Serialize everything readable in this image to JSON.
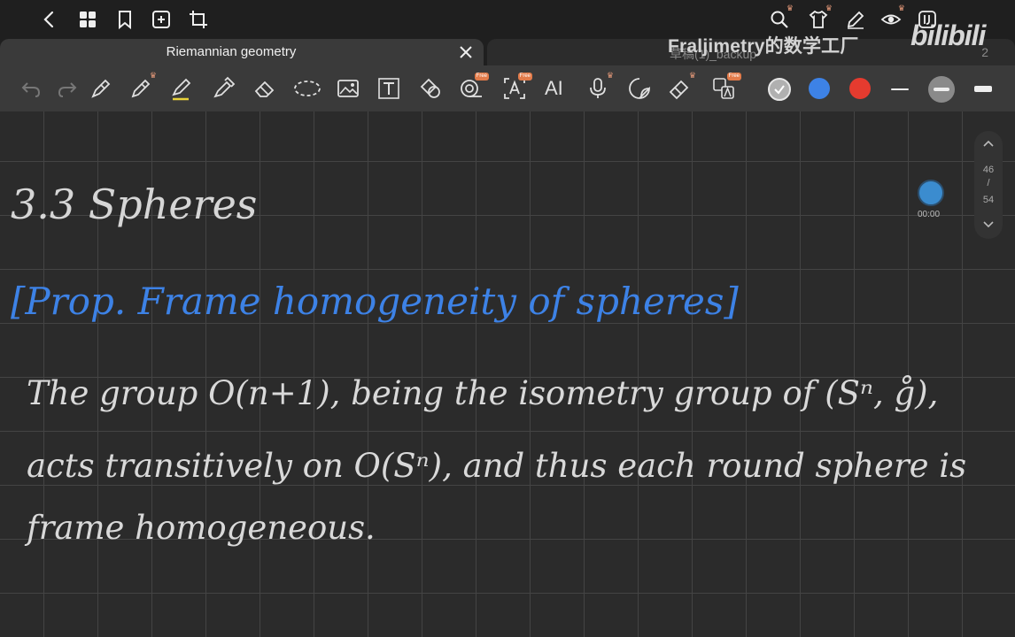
{
  "tabs": {
    "active": "Riemannian geometry",
    "inactive": "草稿(1)_backup",
    "inactive_count": "2"
  },
  "watermark": {
    "channel": "Fraljimetry的数学工厂",
    "site": "bilibili"
  },
  "pagination": {
    "current": "46",
    "separator": "/",
    "total": "54"
  },
  "recording": {
    "time": "00:00"
  },
  "toolbar": {
    "ai_label": "AI",
    "free_badge": "Free"
  },
  "colors": {
    "background": "#2b2b2b",
    "toolbar": "#3a3a3a",
    "swatch_gray": "#b0b0b0",
    "swatch_blue": "#3d82e6",
    "swatch_red": "#e53b2f",
    "ink_white": "#d9d9d9",
    "ink_blue": "#3d82e6"
  },
  "note": {
    "heading": "3.3   Spheres",
    "prop_title": "[Prop. Frame homogeneity of spheres]",
    "line1": "The group O(n+1), being the isometry group of (Sⁿ, g̊),",
    "line2": "acts transitively on O(Sⁿ), and thus each round sphere is",
    "line3": "frame homogeneous."
  }
}
